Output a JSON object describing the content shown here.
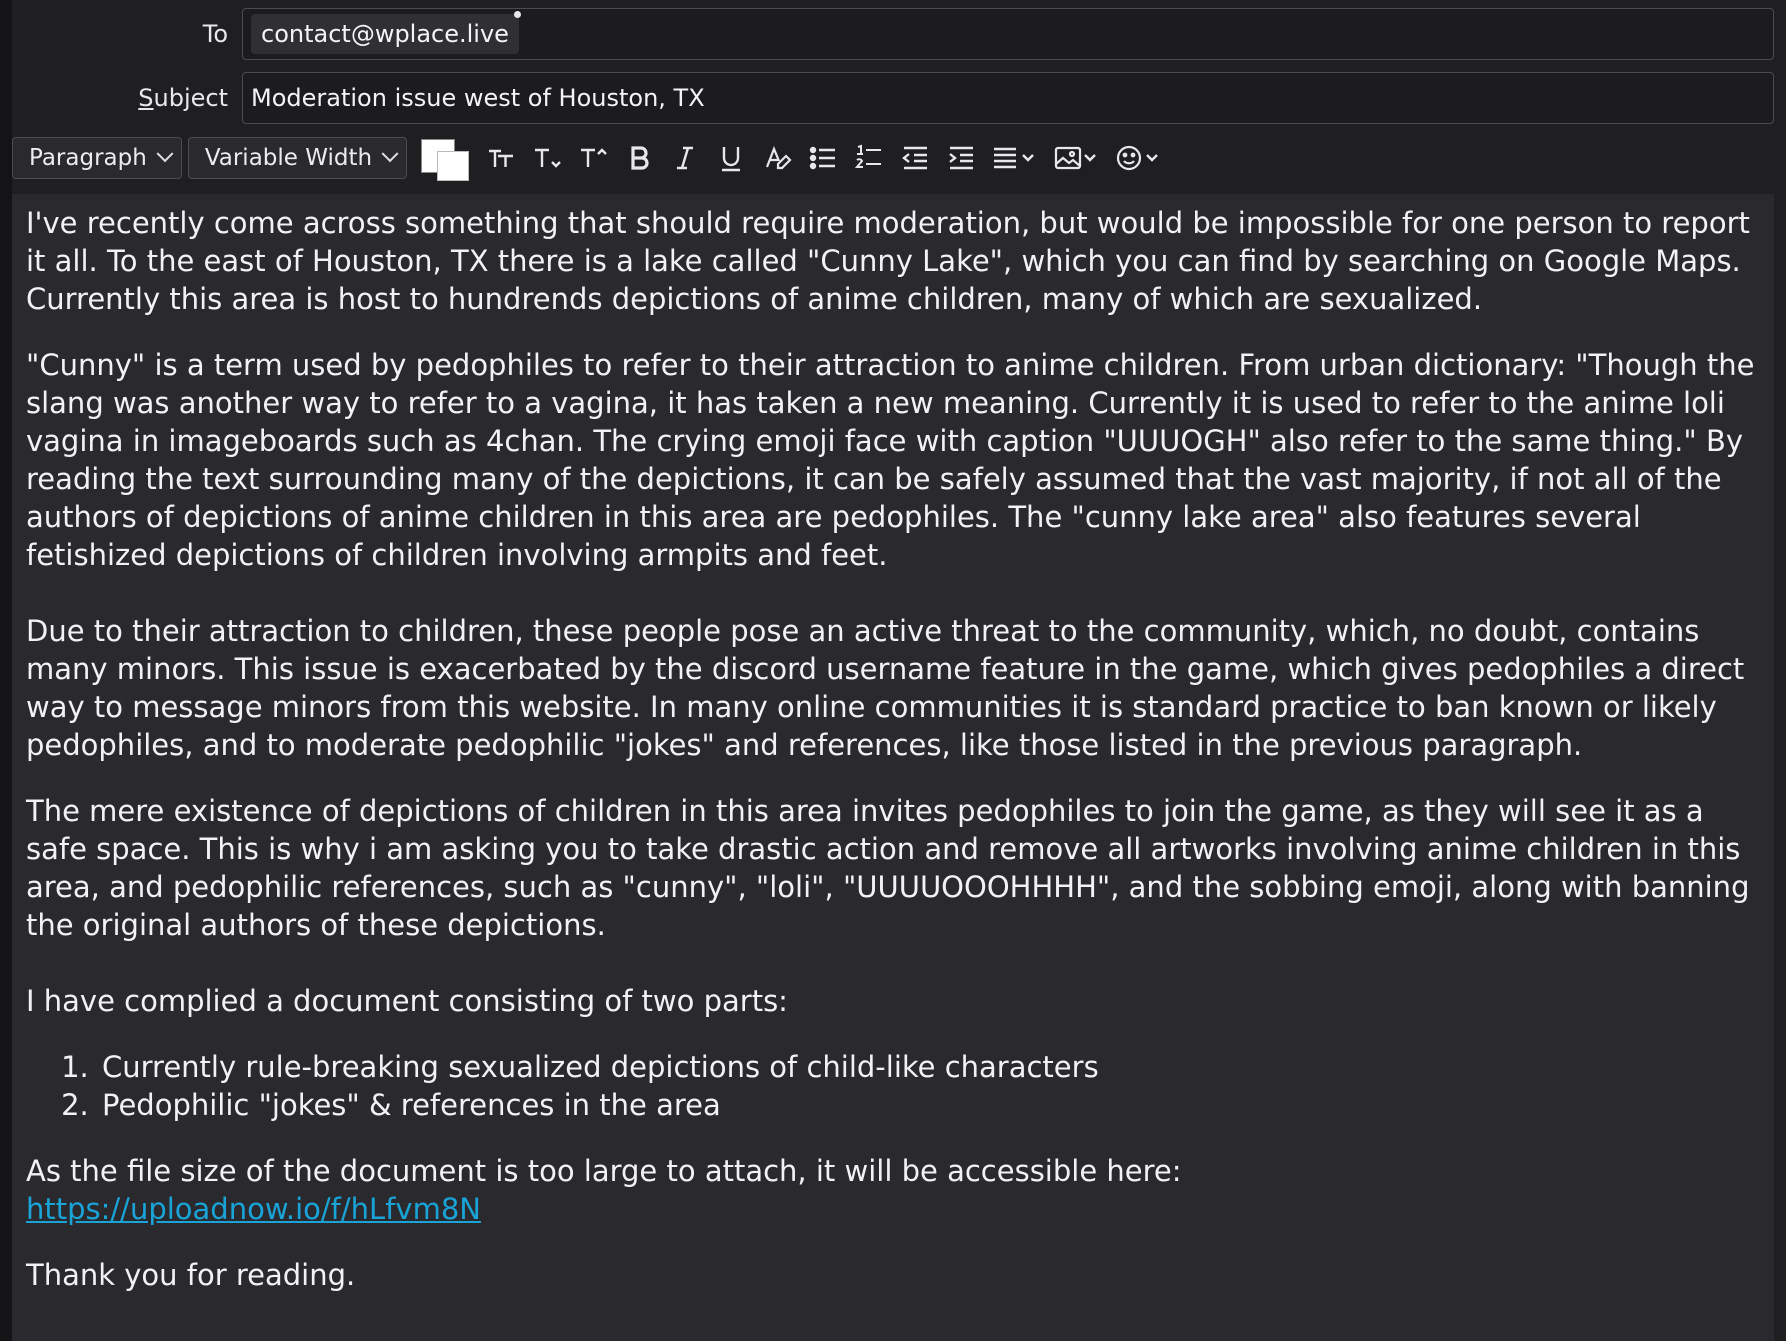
{
  "header": {
    "to_label": "To",
    "to_value": "contact@wplace.live",
    "subject_label": "Subject",
    "subject_value": "Moderation issue west of Houston, TX"
  },
  "toolbar": {
    "paragraph_format": "Paragraph",
    "font_family": "Variable Width",
    "text_color": "#ffffff",
    "background_color": "#ffffff",
    "buttons": [
      "font-size-icon",
      "decrease-font-icon",
      "increase-font-icon",
      "bold-icon",
      "italic-icon",
      "underline-icon",
      "clear-format-icon",
      "bulleted-list-icon",
      "numbered-list-icon",
      "outdent-icon",
      "indent-icon",
      "align-icon",
      "insert-image-icon",
      "emoji-icon"
    ]
  },
  "body": {
    "p1": "I've recently come across something that should require moderation, but would be impossible for one person to report it all. To the east of Houston, TX there is a lake called \"Cunny Lake\", which you can find by searching on Google Maps. Currently this area is host to hundrends depictions of anime children, many of which are sexualized.",
    "p2": "\"Cunny\" is a term used by pedophiles to refer to their attraction to anime children. From urban dictionary: \"Though the slang was another way to refer to a vagina, it has taken a new meaning. Currently it is used to refer to the anime loli vagina in imageboards such as 4chan. The crying emoji face with caption \"UUUOGH\" also refer to the same thing.\" By reading the text surrounding many of the depictions, it can be safely assumed that the vast majority, if not all of the authors of depictions of anime children in this area are pedophiles. The \"cunny lake area\" also features several fetishized depictions of children involving armpits and feet.",
    "p3": "Due to their attraction to children, these people pose an active threat to the community, which, no doubt, contains many minors. This issue is exacerbated by the discord username feature in the game, which gives pedophiles a direct way to message minors from this website. In many online communities it is standard practice to ban known or likely pedophiles, and to moderate pedophilic \"jokes\" and references, like those listed in the previous paragraph.",
    "p4": "The mere existence of depictions of children in this area invites pedophiles to join the game, as they will see it as a safe space. This is why i am asking you to take drastic action and remove all artworks involving anime children in this area, and pedophilic references, such as \"cunny\", \"loli\", \"UUUUOOOHHHH\", and the sobbing emoji, along with banning the original authors of these depictions.",
    "p5": "I have complied a document consisting of two parts:",
    "list": [
      "Currently rule-breaking sexualized depictions of child-like characters",
      "Pedophilic \"jokes\" & references in the area"
    ],
    "p6": "As the file size of the document is too large to attach, it will be accessible here:",
    "link": "https://uploadnow.io/f/hLfvm8N",
    "p7": "Thank you for reading."
  }
}
